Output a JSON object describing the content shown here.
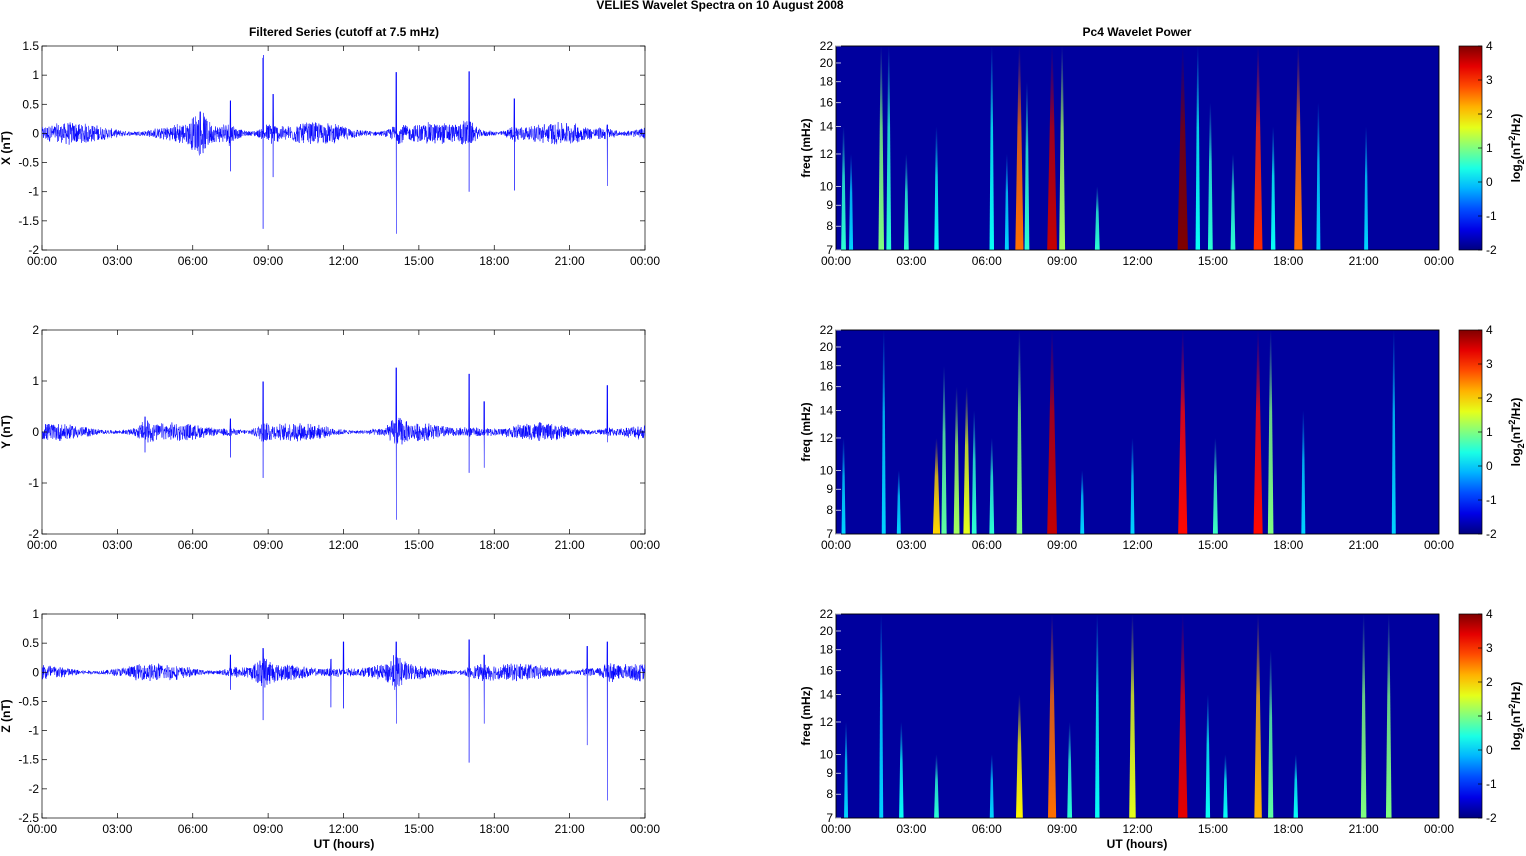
{
  "chart_data": {
    "title": "VELIES Wavelet Spectra on 10 August    2008",
    "left_title": "Filtered Series (cutoff at 7.5 mHz)",
    "right_title": "Pc4 Wavelet Power",
    "xlabel": "UT (hours)",
    "x_ticks": [
      "00:00",
      "03:00",
      "06:00",
      "09:00",
      "12:00",
      "15:00",
      "18:00",
      "21:00",
      "00:00"
    ],
    "xlim_hours": [
      0,
      24
    ],
    "time_series": [
      {
        "type": "line",
        "component": "X",
        "ylabel": "X (nT)",
        "ylim": [
          -2,
          1.5
        ],
        "y_ticks": [
          "1.5",
          "1",
          "0.5",
          "0",
          "-0.5",
          "-1",
          "-1.5",
          "-2"
        ],
        "noise_amp": 0.15,
        "color": "#0000ff",
        "spikes": [
          [
            6.3,
            0.5,
            -0.35
          ],
          [
            7.5,
            0.75,
            -0.65
          ],
          [
            8.8,
            1.42,
            -1.32
          ],
          [
            9.2,
            0.9,
            -0.75
          ],
          [
            14.1,
            1.4,
            -1.72
          ],
          [
            17.0,
            1.42,
            -1.0
          ],
          [
            18.8,
            0.8,
            -0.98
          ],
          [
            22.5,
            0.2,
            -0.9
          ]
        ]
      },
      {
        "type": "line",
        "component": "Y",
        "ylabel": "Y (nT)",
        "ylim": [
          -2,
          2
        ],
        "y_ticks": [
          "2",
          "1",
          "0",
          "-1",
          "-2"
        ],
        "noise_amp": 0.14,
        "color": "#0000ff",
        "spikes": [
          [
            4.1,
            0.4,
            -0.4
          ],
          [
            7.5,
            0.35,
            -0.5
          ],
          [
            8.8,
            1.32,
            -0.9
          ],
          [
            14.1,
            1.68,
            -1.72
          ],
          [
            17.0,
            1.52,
            -0.8
          ],
          [
            17.6,
            0.8,
            -0.7
          ],
          [
            22.5,
            1.22,
            -0.2
          ]
        ]
      },
      {
        "type": "line",
        "component": "Z",
        "ylabel": "Z (nT)",
        "ylim": [
          -2.5,
          1
        ],
        "y_ticks": [
          "1",
          "0.5",
          "0",
          "-0.5",
          "-1",
          "-1.5",
          "-2",
          "-2.5"
        ],
        "noise_amp": 0.12,
        "color": "#0000ff",
        "spikes": [
          [
            7.5,
            0.4,
            -0.3
          ],
          [
            8.8,
            0.55,
            -0.82
          ],
          [
            11.5,
            0.3,
            -0.6
          ],
          [
            12.0,
            0.7,
            -0.62
          ],
          [
            14.1,
            0.7,
            -0.88
          ],
          [
            17.0,
            0.75,
            -1.55
          ],
          [
            17.6,
            0.4,
            -0.88
          ],
          [
            21.7,
            0.6,
            -1.25
          ],
          [
            22.5,
            0.7,
            -2.2
          ]
        ]
      }
    ],
    "wavelet": [
      {
        "type": "heatmap",
        "component": "X",
        "ylabel": "freq (mHz)",
        "events": [
          [
            0.3,
            0.5,
            14
          ],
          [
            0.6,
            0,
            12
          ],
          [
            1.8,
            1,
            22
          ],
          [
            2.1,
            0.5,
            22
          ],
          [
            2.8,
            0.5,
            12
          ],
          [
            4.0,
            0.3,
            14
          ],
          [
            6.2,
            0.3,
            22
          ],
          [
            6.8,
            0,
            12
          ],
          [
            7.3,
            2.6,
            22
          ],
          [
            7.6,
            0.5,
            18
          ],
          [
            8.6,
            3.6,
            22
          ],
          [
            9.0,
            1.2,
            22
          ],
          [
            10.4,
            0.5,
            10
          ],
          [
            13.8,
            4,
            22
          ],
          [
            14.4,
            0.3,
            22
          ],
          [
            14.9,
            0.5,
            16
          ],
          [
            15.8,
            0.5,
            12
          ],
          [
            16.8,
            3,
            22
          ],
          [
            17.4,
            0.3,
            14
          ],
          [
            18.4,
            2.6,
            22
          ],
          [
            19.2,
            0,
            16
          ],
          [
            21.1,
            0,
            14
          ]
        ]
      },
      {
        "type": "heatmap",
        "component": "Y",
        "ylabel": "freq (mHz)",
        "events": [
          [
            0.3,
            0,
            12
          ],
          [
            1.9,
            0,
            22
          ],
          [
            2.5,
            0,
            10
          ],
          [
            4.0,
            2,
            12
          ],
          [
            4.3,
            0.8,
            18
          ],
          [
            4.8,
            1.2,
            16
          ],
          [
            5.2,
            1.6,
            16
          ],
          [
            5.5,
            0.5,
            14
          ],
          [
            6.2,
            0.5,
            12
          ],
          [
            7.3,
            1,
            22
          ],
          [
            8.6,
            3.6,
            22
          ],
          [
            9.8,
            0,
            10
          ],
          [
            11.8,
            0,
            12
          ],
          [
            13.8,
            3.2,
            22
          ],
          [
            15.1,
            0.6,
            12
          ],
          [
            16.8,
            3.2,
            22
          ],
          [
            17.3,
            1,
            22
          ],
          [
            18.6,
            0,
            14
          ],
          [
            22.2,
            0,
            22
          ]
        ]
      },
      {
        "type": "heatmap",
        "component": "Z",
        "ylabel": "freq (mHz)",
        "events": [
          [
            0.4,
            0,
            12
          ],
          [
            1.8,
            0,
            22
          ],
          [
            2.6,
            0.3,
            12
          ],
          [
            4.0,
            0.5,
            10
          ],
          [
            6.2,
            0,
            10
          ],
          [
            7.3,
            1.8,
            14
          ],
          [
            8.6,
            2.6,
            22
          ],
          [
            9.3,
            0.5,
            12
          ],
          [
            10.4,
            0.3,
            22
          ],
          [
            11.8,
            1.6,
            22
          ],
          [
            13.8,
            3.4,
            22
          ],
          [
            14.8,
            0.3,
            14
          ],
          [
            15.5,
            0.3,
            10
          ],
          [
            16.8,
            2.2,
            22
          ],
          [
            17.3,
            0.8,
            18
          ],
          [
            18.3,
            0.3,
            10
          ],
          [
            21.0,
            1,
            22
          ],
          [
            22.0,
            1,
            22
          ]
        ]
      }
    ],
    "freq_ticks": [
      "22",
      "20",
      "18",
      "16",
      "14",
      "12",
      "10",
      "9",
      "8",
      "7"
    ],
    "freq_lim_mhz": [
      7,
      22
    ],
    "colorbar": {
      "clim": [
        -2,
        4
      ],
      "ticks": [
        "4",
        "3",
        "2",
        "1",
        "0",
        "-1",
        "-2"
      ],
      "colormap": "jet",
      "label": {
        "base": "log",
        "sub": "2",
        "open": "(nT",
        "sup": "2",
        "close": "/Hz)"
      }
    }
  }
}
